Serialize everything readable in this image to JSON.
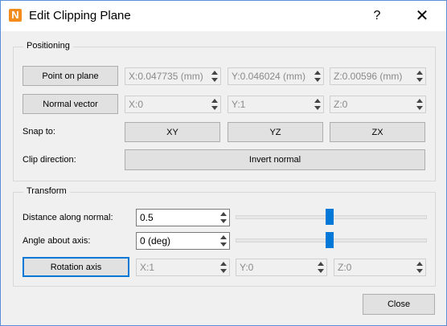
{
  "window": {
    "title": "Edit Clipping Plane",
    "app_icon_letter": "N",
    "help_label": "?",
    "close_label": "✕"
  },
  "positioning": {
    "title": "Positioning",
    "point_button": "Point on plane",
    "point": {
      "x": "X:0.047735 (mm)",
      "y": "Y:0.046024 (mm)",
      "z": "Z:0.00596 (mm)"
    },
    "normal_button": "Normal vector",
    "normal": {
      "x": "X:0",
      "y": "Y:1",
      "z": "Z:0"
    },
    "snap_label": "Snap to:",
    "snap_buttons": {
      "xy": "XY",
      "yz": "YZ",
      "zx": "ZX"
    },
    "clip_label": "Clip direction:",
    "invert_button": "Invert normal"
  },
  "transform": {
    "title": "Transform",
    "distance_label": "Distance along normal:",
    "distance_value": "0.5",
    "distance_slider_fraction": 0.5,
    "angle_label": "Angle about axis:",
    "angle_value": "0 (deg)",
    "angle_slider_fraction": 0.5,
    "rotation_button": "Rotation axis",
    "rotation": {
      "x": "X:1",
      "y": "Y:0",
      "z": "Z:0"
    }
  },
  "footer": {
    "close_button": "Close"
  }
}
